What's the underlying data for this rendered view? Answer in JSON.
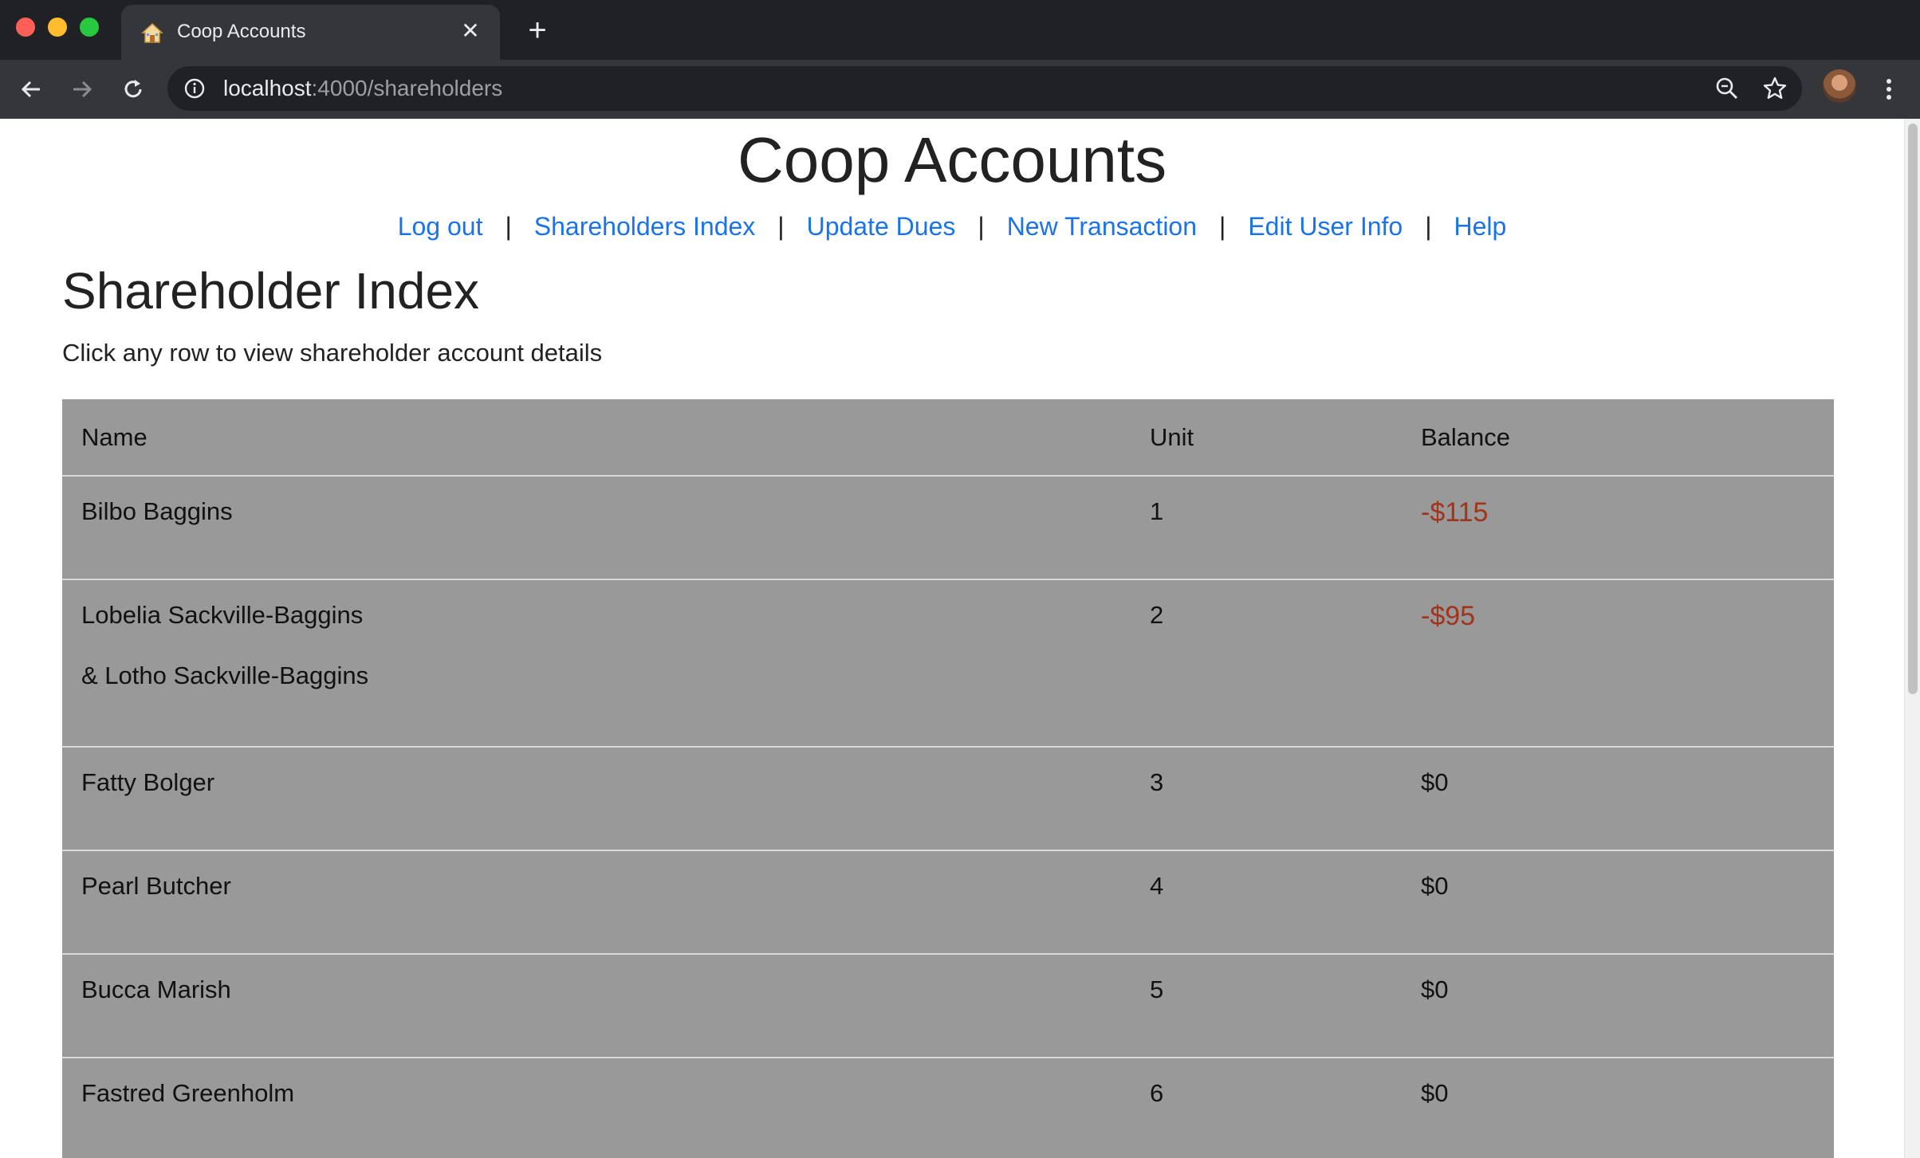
{
  "browser": {
    "tab_title": "Coop Accounts",
    "url_host": "localhost",
    "url_path": ":4000/shareholders"
  },
  "page": {
    "site_title": "Coop Accounts",
    "nav": [
      {
        "label": "Log out"
      },
      {
        "label": "Shareholders Index"
      },
      {
        "label": "Update Dues"
      },
      {
        "label": "New Transaction"
      },
      {
        "label": "Edit User Info"
      },
      {
        "label": "Help"
      }
    ],
    "nav_separator": "|",
    "heading": "Shareholder Index",
    "instructions": "Click any row to view shareholder account details",
    "table": {
      "headers": [
        "Name",
        "Unit",
        "Balance"
      ],
      "rows": [
        {
          "name": "Bilbo Baggins",
          "name2": "",
          "unit": "1",
          "balance": "-$115",
          "negative": true
        },
        {
          "name": "Lobelia Sackville-Baggins",
          "name2": "& Lotho Sackville-Baggins",
          "unit": "2",
          "balance": "-$95",
          "negative": true
        },
        {
          "name": "Fatty Bolger",
          "name2": "",
          "unit": "3",
          "balance": "$0",
          "negative": false
        },
        {
          "name": "Pearl Butcher",
          "name2": "",
          "unit": "4",
          "balance": "$0",
          "negative": false
        },
        {
          "name": "Bucca Marish",
          "name2": "",
          "unit": "5",
          "balance": "$0",
          "negative": false
        },
        {
          "name": "Fastred Greenholm",
          "name2": "",
          "unit": "6",
          "balance": "$0",
          "negative": false
        }
      ]
    }
  },
  "colors": {
    "link": "#1a73e8",
    "negative_balance": "#a0341c",
    "table_bg": "#999999"
  },
  "icons": [
    "house-favicon-icon",
    "close-icon",
    "plus-icon",
    "back-arrow-icon",
    "forward-arrow-icon",
    "reload-icon",
    "info-icon",
    "zoom-icon",
    "star-icon",
    "kebab-menu-icon"
  ]
}
